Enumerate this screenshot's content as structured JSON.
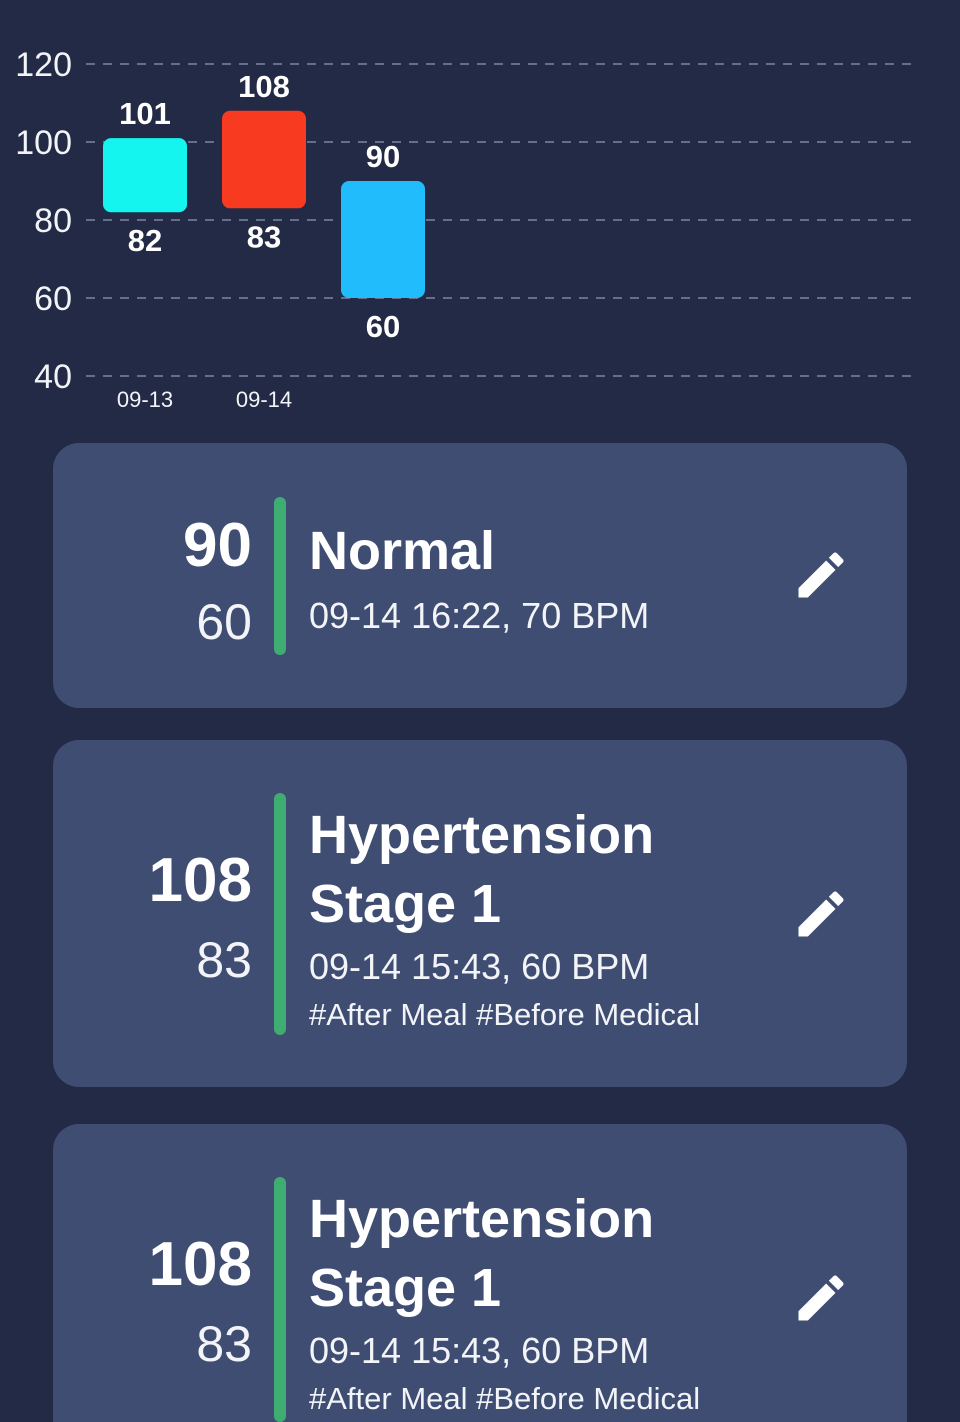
{
  "chart_data": {
    "type": "floating-bar",
    "y_ticks": [
      120,
      100,
      80,
      60,
      40
    ],
    "ylim": [
      40,
      120
    ],
    "grid": true,
    "bars": [
      {
        "x_label": "09-13",
        "high": 101,
        "low": 82,
        "color": "#14f5f0"
      },
      {
        "x_label": "09-14",
        "high": 108,
        "low": 83,
        "color": "#f83a20"
      },
      {
        "x_label": "",
        "high": 90,
        "low": 60,
        "color": "#20bcfb"
      }
    ]
  },
  "records": [
    {
      "systolic": "90",
      "diastolic": "60",
      "status_lines": [
        "Normal"
      ],
      "meta": "09-14 16:22, 70 BPM",
      "tags": "",
      "indicator_color": "#3fac72"
    },
    {
      "systolic": "108",
      "diastolic": "83",
      "status_lines": [
        "Hypertension",
        "Stage 1"
      ],
      "meta": "09-14 15:43, 60 BPM",
      "tags": "#After Meal #Before Medical",
      "indicator_color": "#3fac72"
    },
    {
      "systolic": "108",
      "diastolic": "83",
      "status_lines": [
        "Hypertension",
        "Stage 1"
      ],
      "meta": "09-14 15:43, 60 BPM",
      "tags": "#After Meal #Before Medical",
      "indicator_color": "#3fac72"
    }
  ],
  "icons": {
    "edit": "pencil-icon"
  }
}
